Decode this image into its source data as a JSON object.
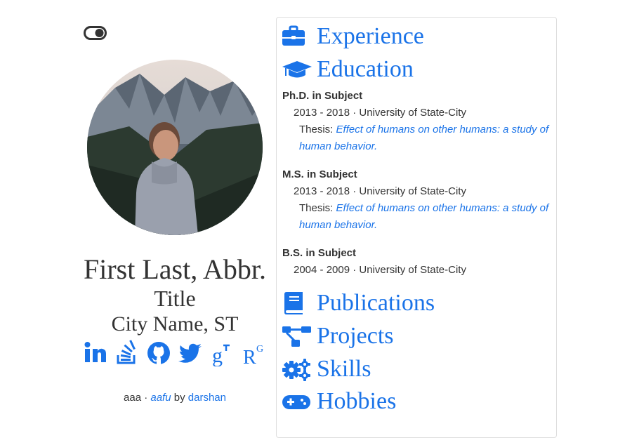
{
  "theme_toggle": {
    "icon": "toggle-icon"
  },
  "profile": {
    "name": "First Last, Abbr.",
    "title": "Title",
    "location": "City Name, ST",
    "avatar_icon": "profile-photo"
  },
  "socials": [
    {
      "name": "linkedin",
      "icon": "linkedin-icon"
    },
    {
      "name": "stackoverflow",
      "icon": "stackoverflow-icon"
    },
    {
      "name": "github",
      "icon": "github-icon"
    },
    {
      "name": "twitter",
      "icon": "twitter-icon"
    },
    {
      "name": "google-scholar",
      "icon": "google-scholar-icon"
    },
    {
      "name": "researchgate",
      "icon": "researchgate-icon"
    }
  ],
  "footer": {
    "prefix": "aaa · ",
    "link1": "aafu",
    "mid": " by ",
    "link2": "darshan"
  },
  "sections": {
    "experience": {
      "label": "Experience",
      "icon": "briefcase-icon"
    },
    "education": {
      "label": "Education",
      "icon": "graduation-cap-icon"
    },
    "publications": {
      "label": "Publications",
      "icon": "book-icon"
    },
    "projects": {
      "label": "Projects",
      "icon": "project-diagram-icon"
    },
    "skills": {
      "label": "Skills",
      "icon": "gears-icon"
    },
    "hobbies": {
      "label": "Hobbies",
      "icon": "gamepad-icon"
    }
  },
  "education": [
    {
      "degree": "Ph.D. in Subject",
      "years": "2013 - 2018 · University of State-City",
      "thesis_label": "Thesis: ",
      "thesis": "Effect of humans on other humans: a study of human behavior."
    },
    {
      "degree": "M.S. in Subject",
      "years": "2013 - 2018 · University of State-City",
      "thesis_label": "Thesis: ",
      "thesis": "Effect of humans on other humans: a study of human behavior."
    },
    {
      "degree": "B.S. in Subject",
      "years": "2004 - 2009 · University of State-City"
    }
  ],
  "colors": {
    "accent": "#1a73e8",
    "text": "#333333",
    "border": "#dddddd"
  }
}
